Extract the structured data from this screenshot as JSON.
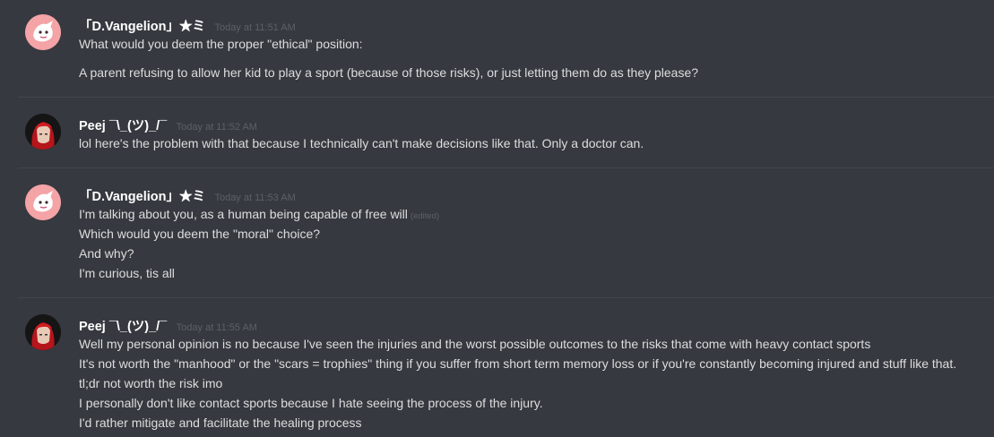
{
  "messages": [
    {
      "author": "「D.Vangelion」★ミ",
      "timestamp": "Today at 11:51 AM",
      "avatar": "pink-cartoon-avatar",
      "lines": [
        "What would you deem the proper \"ethical\" position:",
        "A parent refusing to allow her kid to play a sport (because of those risks), or just letting them do as they please?"
      ]
    },
    {
      "author": "Peej ¯\\_(ツ)_/¯",
      "timestamp": "Today at 11:52 AM",
      "avatar": "red-hair-portrait-avatar",
      "lines": [
        "lol here's the problem with that because I technically can't make decisions like that. Only a doctor can."
      ]
    },
    {
      "author": "「D.Vangelion」★ミ",
      "timestamp": "Today at 11:53 AM",
      "avatar": "pink-cartoon-avatar",
      "lines": [
        "I'm talking about you, as a human being capable of free will",
        "Which would you deem the \"moral\" choice?",
        "And why?",
        "I'm curious, tis all"
      ],
      "edited_label": "(edited)"
    },
    {
      "author": "Peej ¯\\_(ツ)_/¯",
      "timestamp": "Today at 11:55 AM",
      "avatar": "red-hair-portrait-avatar",
      "lines": [
        "Well my personal opinion is no because I've seen the injuries and the worst possible outcomes to the risks that come with heavy contact sports",
        "It's not worth the \"manhood\" or the \"scars = trophies\" thing if you suffer from short term memory loss or if you're constantly becoming injured and stuff like that.",
        "tl;dr not worth the risk imo",
        "I personally don't like contact sports because I hate seeing the process of the injury.",
        "I'd rather mitigate and facilitate the healing process"
      ]
    }
  ],
  "colors": {
    "background": "#36393f",
    "author": "#ffffff",
    "text": "#dcddde",
    "timestamp": "#5d6067",
    "divider": "#42454a"
  }
}
